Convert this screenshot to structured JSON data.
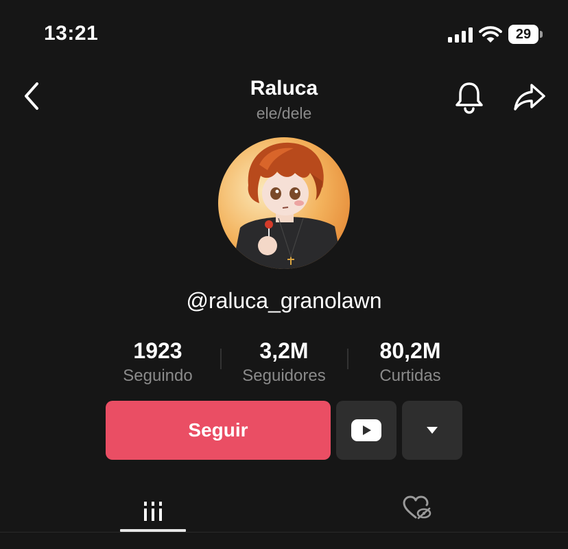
{
  "status_bar": {
    "time": "13:21",
    "battery": "29",
    "icons": [
      "cellular-signal-icon",
      "wifi-icon",
      "battery-icon"
    ]
  },
  "header": {
    "name": "Raluca",
    "pronouns": "ele/dele",
    "icons": [
      "back-chevron-icon",
      "bell-icon",
      "share-arrow-icon"
    ]
  },
  "profile": {
    "username": "@raluca_granolawn",
    "avatar_desc": "avatar-illustration"
  },
  "stats": [
    {
      "value": "1923",
      "label": "Seguindo"
    },
    {
      "value": "3,2M",
      "label": "Seguidores"
    },
    {
      "value": "80,2M",
      "label": "Curtidas"
    }
  ],
  "actions": {
    "follow_label": "Seguir",
    "youtube_icon": "youtube-icon",
    "more_icon": "caret-down-icon"
  },
  "tabs": [
    {
      "name": "videos",
      "icon": "grid-bars-icon",
      "active": true
    },
    {
      "name": "liked",
      "icon": "heart-hidden-icon",
      "active": false
    }
  ],
  "colors": {
    "background": "#161616",
    "accent": "#ea4e64",
    "secondary_button": "#2e2e2e",
    "muted_text": "#8a8a8a"
  }
}
